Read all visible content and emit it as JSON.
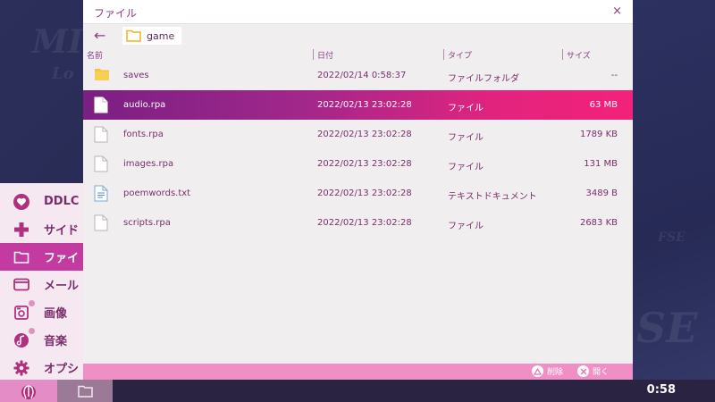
{
  "background": {
    "texts": [
      "MI",
      "Lo",
      "SE",
      "FSE"
    ]
  },
  "window": {
    "title": "ファイル",
    "close_glyph": "×",
    "back_glyph": "←",
    "path": "game"
  },
  "columns": {
    "name": "名前",
    "date": "日付",
    "type": "タイプ",
    "size": "サイズ"
  },
  "files": [
    {
      "name": "saves",
      "date": "2022/02/14 0:58:37",
      "type": "ファイルフォルダ",
      "size": "--",
      "icon": "folder-icon",
      "selected": false
    },
    {
      "name": "audio.rpa",
      "date": "2022/02/13 23:02:28",
      "type": "ファイル",
      "size": "63 MB",
      "icon": "file-icon",
      "selected": true
    },
    {
      "name": "fonts.rpa",
      "date": "2022/02/13 23:02:28",
      "type": "ファイル",
      "size": "1789 KB",
      "icon": "file-icon",
      "selected": false
    },
    {
      "name": "images.rpa",
      "date": "2022/02/13 23:02:28",
      "type": "ファイル",
      "size": "131 MB",
      "icon": "file-icon",
      "selected": false
    },
    {
      "name": "poemwords.txt",
      "date": "2022/02/13 23:02:28",
      "type": "テキストドキュメント",
      "size": "3489 B",
      "icon": "text-file-icon",
      "selected": false
    },
    {
      "name": "scripts.rpa",
      "date": "2022/02/13 23:02:28",
      "type": "ファイル",
      "size": "2683 KB",
      "icon": "file-icon",
      "selected": false
    }
  ],
  "footer": {
    "delete_label": "削除",
    "open_label": "開く"
  },
  "sidebar": {
    "items": [
      {
        "label": "DDLC",
        "icon": "heart-icon"
      },
      {
        "label": "サイド",
        "icon": "plus-icon"
      },
      {
        "label": "ファイ",
        "icon": "folder-icon",
        "active": true
      },
      {
        "label": "メール",
        "icon": "mail-icon"
      },
      {
        "label": "画像",
        "icon": "image-icon",
        "badge": true
      },
      {
        "label": "音楽",
        "icon": "music-icon",
        "badge": true
      },
      {
        "label": "オプシ",
        "icon": "gear-icon"
      }
    ]
  },
  "taskbar": {
    "clock": "0:58"
  },
  "colors": {
    "accent": "#c33aa0",
    "text_purple": "#7a2d6b",
    "footer_pink": "#ef8fc6",
    "folder_yellow": "#f6c344",
    "selection_start": "#7a1f83",
    "selection_end": "#f3227a"
  }
}
